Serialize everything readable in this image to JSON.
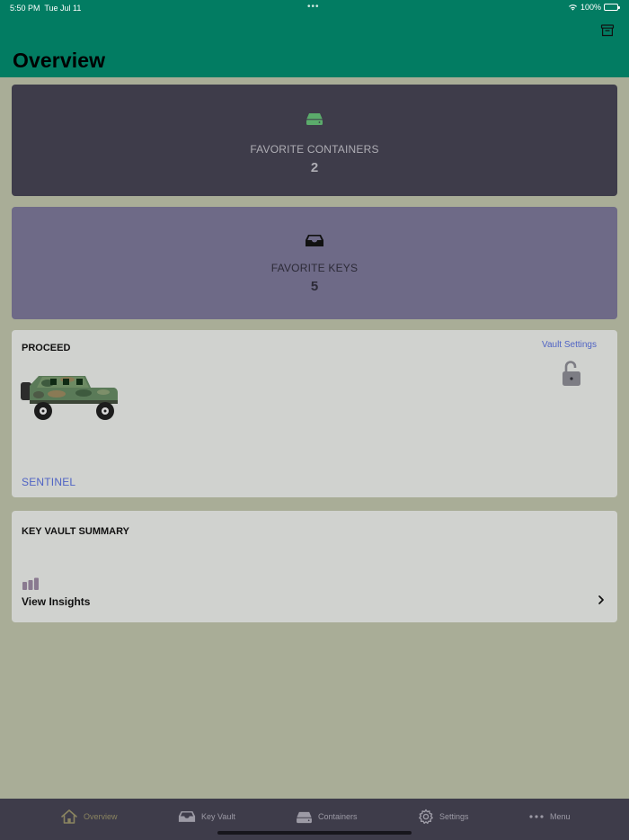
{
  "status_bar": {
    "time": "5:50 PM",
    "date": "Tue Jul 11",
    "dots": "•••",
    "battery": "100%",
    "icons": [
      "wifi-icon",
      "battery-icon"
    ]
  },
  "header": {
    "title": "Overview",
    "action_icon": "archive-icon"
  },
  "favorite_containers": {
    "label": "FAVORITE CONTAINERS",
    "value": "2",
    "icon": "drive-icon"
  },
  "favorite_keys": {
    "label": "FAVORITE KEYS",
    "value": "5",
    "icon": "tray-icon"
  },
  "proceed": {
    "title": "PROCEED",
    "vault_settings_label": "Vault Settings",
    "vehicle_name": "SENTINEL",
    "lock_icon": "unlocked-padlock-icon"
  },
  "summary": {
    "title": "KEY VAULT SUMMARY",
    "insights_label": "View Insights",
    "icon": "bar-chart-icon"
  },
  "tabs": [
    {
      "label": "Overview",
      "icon": "house-icon",
      "active": true
    },
    {
      "label": "Key Vault",
      "icon": "tray-icon",
      "active": false
    },
    {
      "label": "Containers",
      "icon": "drive-icon",
      "active": false
    },
    {
      "label": "Settings",
      "icon": "gear-icon",
      "active": false
    },
    {
      "label": "Menu",
      "icon": "more-dots-icon",
      "active": false
    }
  ],
  "colors": {
    "header": "#027c62",
    "background": "#a9ad97",
    "containers_card": "#3e3c4a",
    "keys_card": "#6e6a87",
    "panel": "#d0d2cf",
    "accent_link": "#4f63c4",
    "tab_bar": "#3e3c4a",
    "active_tab": "#8a8460"
  }
}
